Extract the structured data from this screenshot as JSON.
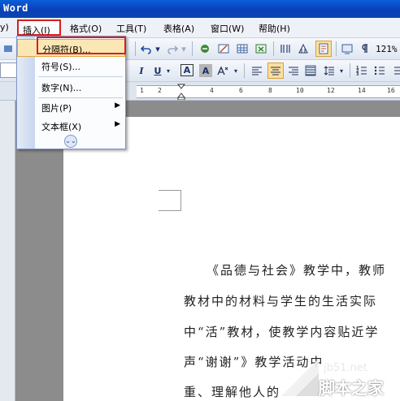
{
  "app": {
    "title": "Word"
  },
  "menubar": {
    "partial_left": "y)",
    "items": [
      {
        "label": "插入(I)"
      },
      {
        "label": "格式(O)"
      },
      {
        "label": "工具(T)"
      },
      {
        "label": "表格(A)"
      },
      {
        "label": "窗口(W)"
      },
      {
        "label": "帮助(H)"
      }
    ]
  },
  "insert_menu": {
    "items": [
      {
        "label": "分隔符(B)...",
        "submenu": false
      },
      {
        "label": "符号(S)...",
        "submenu": false
      },
      {
        "label": "数字(N)...",
        "submenu": false
      },
      {
        "label": "图片(P)",
        "submenu": true
      },
      {
        "label": "文本框(X)",
        "submenu": true
      }
    ],
    "expand_icon": "double-chevron-down-icon"
  },
  "toolbar": {
    "zoom": "121%",
    "icons": [
      "undo-icon",
      "redo-icon",
      "hyperlink-icon",
      "table-icon",
      "columns-icon",
      "drawing-icon",
      "zoom-icon"
    ]
  },
  "format_toolbar": {
    "italic": "I",
    "underline": "U",
    "char_border": "A",
    "char_shading": "A",
    "icons": [
      "align-left-icon",
      "align-center-icon",
      "align-right-icon",
      "justify-icon",
      "line-spacing-icon",
      "numbering-icon",
      "bullets-icon"
    ]
  },
  "ruler": {
    "labels": [
      "1",
      "2",
      "4",
      "6",
      "8",
      "10",
      "12",
      "14",
      "16"
    ]
  },
  "document": {
    "lines": [
      "《品德与社会》教学中，教师",
      "教材中的材料与学生的生活实际",
      "中“活”教材，使教学内容贴近学",
      "声“谢谢”》教学活动中",
      "重、理解他人的"
    ]
  },
  "watermark": {
    "site": "jb51.net",
    "brand": "脚本之家"
  },
  "colors": {
    "highlight_box": "#d42020",
    "titlebar": "#0a4fc8",
    "menu_hover": "#fbe7b4"
  }
}
